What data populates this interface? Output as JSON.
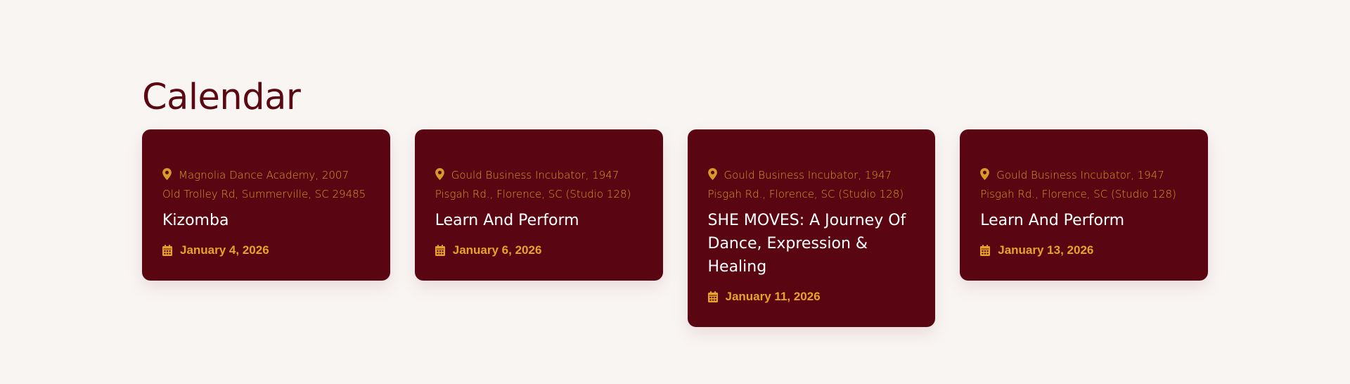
{
  "page": {
    "title": "Calendar"
  },
  "events": [
    {
      "location": "Magnolia Dance Academy, 2007 Old Trolley Rd, Summerville, SC 29485",
      "title": "Kizomba",
      "date": "January 4, 2026"
    },
    {
      "location": "Gould Business Incubator, 1947 Pisgah Rd., Florence, SC (Studio 128)",
      "title": "Learn And Perform",
      "date": "January 6, 2026"
    },
    {
      "location": "Gould Business Incubator, 1947 Pisgah Rd., Florence, SC (Studio 128)",
      "title": "SHE MOVES: A Journey Of Dance, Expression & Healing",
      "date": "January 11, 2026"
    },
    {
      "location": "Gould Business Incubator, 1947 Pisgah Rd., Florence, SC (Studio 128)",
      "title": "Learn And Perform",
      "date": "January 13, 2026"
    }
  ],
  "icons": {
    "location": "map-pin-icon",
    "date": "calendar-icon"
  },
  "colors": {
    "background": "#f9f5f3",
    "heading": "#5a0812",
    "card": "#5a0612",
    "accent": "#e6a22a",
    "card_title": "#ffffff"
  }
}
